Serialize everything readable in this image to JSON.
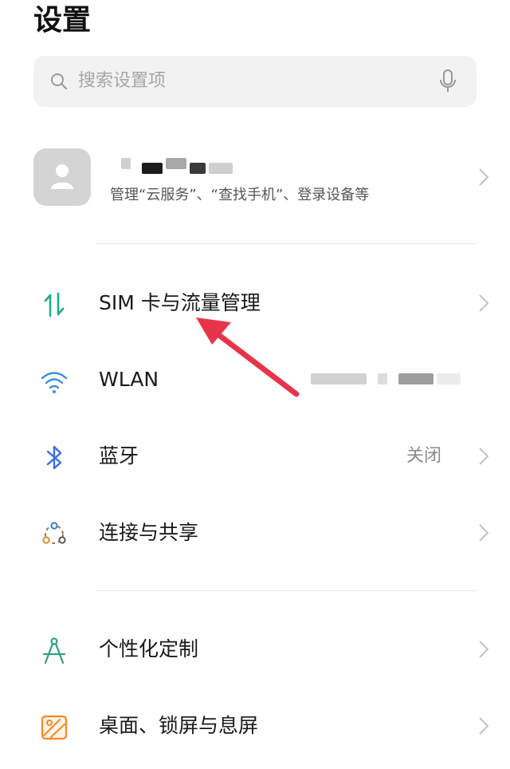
{
  "header": {
    "title": "设置"
  },
  "search": {
    "placeholder": "搜索设置项"
  },
  "account": {
    "subtitle": "管理“云服务”、“查找手机”、登录设备等"
  },
  "settings": [
    {
      "label": "SIM 卡与流量管理",
      "icon": "sim-data-arrows-icon",
      "value": ""
    },
    {
      "label": "WLAN",
      "icon": "wifi-icon",
      "value": ""
    },
    {
      "label": "蓝牙",
      "icon": "bluetooth-icon",
      "value": "关闭"
    },
    {
      "label": "连接与共享",
      "icon": "connection-sharing-icon",
      "value": ""
    },
    {
      "label": "个性化定制",
      "icon": "personalization-compass-icon",
      "value": ""
    },
    {
      "label": "桌面、锁屏与息屏",
      "icon": "wallpaper-icon",
      "value": ""
    }
  ],
  "colors": {
    "sim_icon": "#1fae8f",
    "wifi_icon": "#3b8de0",
    "bluetooth_icon": "#3b6fd8",
    "connection_icon": "#8a6a3a",
    "personalize_icon": "#2fa27a",
    "wallpaper_icon": "#f08a2a",
    "annotation_arrow": "#e8344a"
  }
}
